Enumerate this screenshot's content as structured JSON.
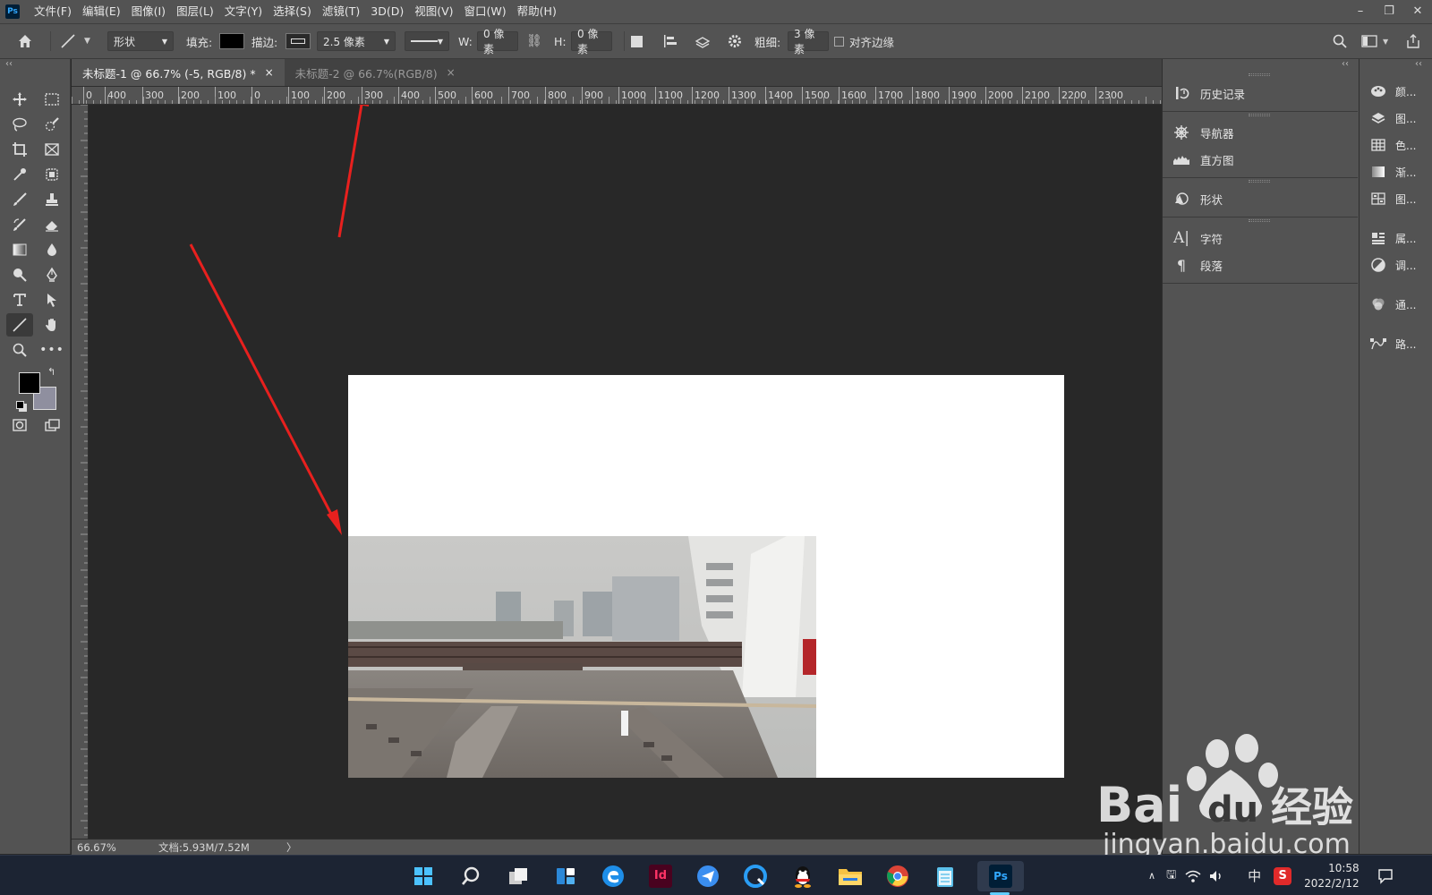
{
  "app": {
    "logo": "Ps"
  },
  "menu": [
    "文件(F)",
    "编辑(E)",
    "图像(I)",
    "图层(L)",
    "文字(Y)",
    "选择(S)",
    "滤镜(T)",
    "3D(D)",
    "视图(V)",
    "窗口(W)",
    "帮助(H)"
  ],
  "window_controls": {
    "minimize": "–",
    "restore": "❐",
    "close": "✕"
  },
  "options": {
    "mode": "形状",
    "fill_label": "填充:",
    "stroke_label": "描边:",
    "stroke_width": "2.5 像素",
    "w_label": "W:",
    "w_value": "0 像素",
    "h_label": "H:",
    "h_value": "0 像素",
    "weight_label": "粗细:",
    "weight_value": "3 像素",
    "align_edges": "对齐边缘",
    "fill_color": "#000000"
  },
  "tabs": [
    {
      "label": "未标题-1 @ 66.7% (-5, RGB/8) *",
      "close": "×",
      "active": true
    },
    {
      "label": "未标题-2 @ 66.7%(RGB/8)",
      "close": "×",
      "active": false
    }
  ],
  "ruler": {
    "h_ticks": [
      "0",
      "400",
      "300",
      "200",
      "100",
      "0",
      "100",
      "200",
      "300",
      "400",
      "500",
      "600",
      "700",
      "800",
      "900",
      "1000",
      "1100",
      "1200",
      "1300",
      "1400",
      "1500",
      "1600",
      "1700",
      "1800",
      "1900",
      "2000",
      "2100",
      "2200",
      "2300"
    ]
  },
  "status": {
    "zoom": "66.67%",
    "doc": "文档:5.93M/7.52M",
    "arrow": "〉"
  },
  "panels": {
    "group1": [
      {
        "icon": "history-icon",
        "label": "历史记录"
      }
    ],
    "group2": [
      {
        "icon": "navigator-icon",
        "label": "导航器"
      },
      {
        "icon": "histogram-icon",
        "label": "直方图"
      }
    ],
    "group3": [
      {
        "icon": "shapes-icon",
        "label": "形状"
      }
    ],
    "group4": [
      {
        "icon": "character-icon",
        "label": "字符"
      },
      {
        "icon": "paragraph-icon",
        "label": "段落"
      }
    ]
  },
  "panels_collapsed": [
    {
      "icon": "color-icon",
      "label": "颜..."
    },
    {
      "icon": "layers-icon",
      "label": "图..."
    },
    {
      "icon": "swatches-icon",
      "label": "色..."
    },
    {
      "icon": "gradient-icon",
      "label": "渐..."
    },
    {
      "icon": "patterns-icon",
      "label": "图..."
    },
    {
      "icon": "properties-icon",
      "label": "属..."
    },
    {
      "icon": "adjustments-icon",
      "label": "调..."
    },
    {
      "icon": "channels-icon",
      "label": "通..."
    },
    {
      "icon": "paths-icon",
      "label": "路..."
    }
  ],
  "taskbar": {
    "apps": [
      "start-icon",
      "search-icon",
      "task-view-icon",
      "widgets-icon",
      "edge-icon",
      "indesign-icon",
      "feishu-icon",
      "browser-icon",
      "qq-icon",
      "explorer-icon",
      "chrome-icon",
      "notepad-icon",
      "photoshop-icon"
    ],
    "indesign_label": "Id",
    "ps_label": "Ps",
    "ime": "中",
    "time": "10:58",
    "date": "2022/2/12"
  },
  "watermark": {
    "brand": "Bai",
    "brand2": "du",
    "suffix": "经验",
    "url": "jingyan.baidu.com"
  },
  "colors": {
    "ui_bg": "#535353",
    "canvas": "#282828",
    "arrow": "#e8201e",
    "accent": "#31a8ff"
  }
}
